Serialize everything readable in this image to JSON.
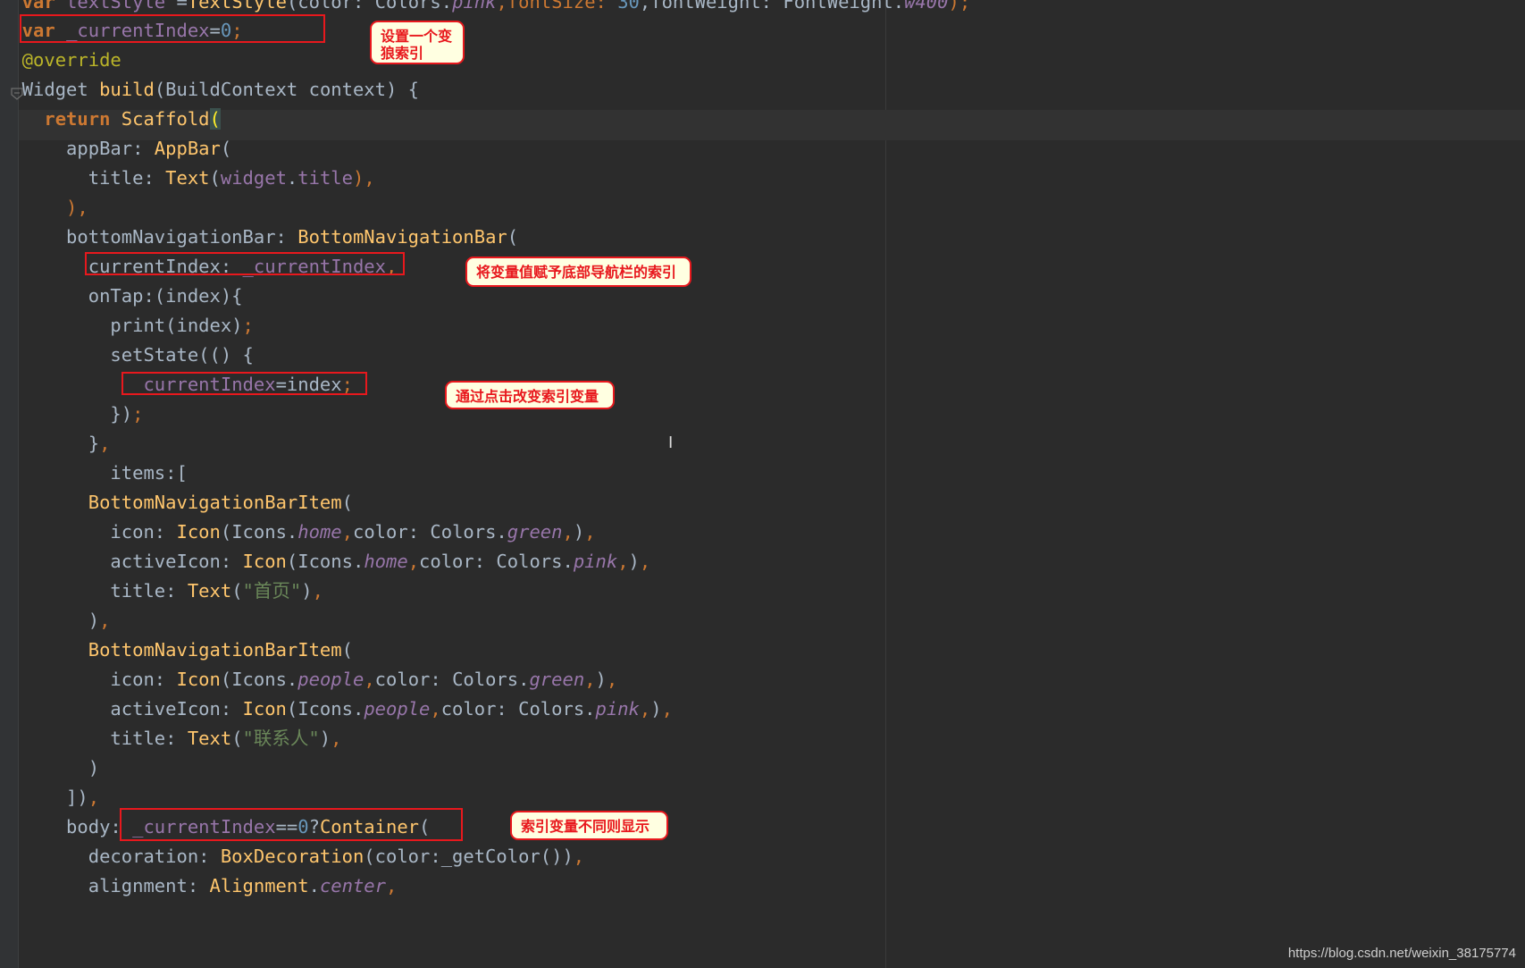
{
  "code_lines": [
    [
      {
        "t": "  var ",
        "c": "kw"
      },
      {
        "t": "textStyle",
        "c": "fld"
      },
      {
        "t": " =",
        "c": "plain"
      },
      {
        "t": "TextStyle",
        "c": "cls"
      },
      {
        "t": "(color: Colors.",
        "c": "plain"
      },
      {
        "t": "pink",
        "c": "it"
      },
      {
        "t": ",fontSize: ",
        "c": "pun"
      },
      {
        "t": "30",
        "c": "num"
      },
      {
        "t": ",fontWeight: FontWeight.",
        "c": "plain"
      },
      {
        "t": "w400",
        "c": "it"
      },
      {
        "t": ");",
        "c": "pun"
      }
    ],
    [
      {
        "t": "  var ",
        "c": "kw"
      },
      {
        "t": "_currentIndex",
        "c": "fld"
      },
      {
        "t": "=",
        "c": "plain"
      },
      {
        "t": "0",
        "c": "num"
      },
      {
        "t": ";",
        "c": "pun"
      }
    ],
    [
      {
        "t": "  @override",
        "c": "ann"
      }
    ],
    [
      {
        "t": "  Widget ",
        "c": "plain"
      },
      {
        "t": "build",
        "c": "cls"
      },
      {
        "t": "(BuildContext context) {",
        "c": "plain"
      }
    ],
    [
      {
        "t": "    return ",
        "c": "kw"
      },
      {
        "t": "Scaffold",
        "c": "cls"
      },
      {
        "t": "(",
        "c": "paren-hl"
      }
    ],
    [
      {
        "t": "      appBar: ",
        "c": "plain"
      },
      {
        "t": "AppBar",
        "c": "cls"
      },
      {
        "t": "(",
        "c": "plain"
      }
    ],
    [
      {
        "t": "        title: ",
        "c": "plain"
      },
      {
        "t": "Text",
        "c": "cls"
      },
      {
        "t": "(",
        "c": "plain"
      },
      {
        "t": "widget",
        "c": "fld"
      },
      {
        "t": ".",
        "c": "plain"
      },
      {
        "t": "title",
        "c": "fld"
      },
      {
        "t": "),",
        "c": "pun"
      }
    ],
    [
      {
        "t": "      ),",
        "c": "pun"
      }
    ],
    [
      {
        "t": "      bottomNavigationBar: ",
        "c": "plain"
      },
      {
        "t": "BottomNavigationBar",
        "c": "cls"
      },
      {
        "t": "(",
        "c": "plain"
      }
    ],
    [
      {
        "t": "        currentIndex: ",
        "c": "plain"
      },
      {
        "t": "_currentIndex",
        "c": "fld"
      },
      {
        "t": ",",
        "c": "pun"
      }
    ],
    [
      {
        "t": "        onTap:(index){",
        "c": "plain"
      }
    ],
    [
      {
        "t": "          print(index)",
        "c": "plain"
      },
      {
        "t": ";",
        "c": "pun"
      }
    ],
    [
      {
        "t": "          setState(() {",
        "c": "plain"
      }
    ],
    [
      {
        "t": "            ",
        "c": "plain"
      },
      {
        "t": "_currentIndex",
        "c": "fld"
      },
      {
        "t": "=index",
        "c": "plain"
      },
      {
        "t": ";",
        "c": "pun"
      }
    ],
    [
      {
        "t": "          })",
        "c": "plain"
      },
      {
        "t": ";",
        "c": "pun"
      }
    ],
    [
      {
        "t": "        }",
        "c": "plain"
      },
      {
        "t": ",",
        "c": "pun"
      }
    ],
    [
      {
        "t": "          items:[",
        "c": "plain"
      }
    ],
    [
      {
        "t": "        ",
        "c": "plain"
      },
      {
        "t": "BottomNavigationBarItem",
        "c": "cls"
      },
      {
        "t": "(",
        "c": "plain"
      }
    ],
    [
      {
        "t": "          icon: ",
        "c": "plain"
      },
      {
        "t": "Icon",
        "c": "cls"
      },
      {
        "t": "(Icons.",
        "c": "plain"
      },
      {
        "t": "home",
        "c": "it"
      },
      {
        "t": ",",
        "c": "pun"
      },
      {
        "t": "color: Colors.",
        "c": "plain"
      },
      {
        "t": "green",
        "c": "it"
      },
      {
        "t": ",",
        "c": "pun"
      },
      {
        "t": ")",
        "c": "plain"
      },
      {
        "t": ",",
        "c": "pun"
      }
    ],
    [
      {
        "t": "          activeIcon: ",
        "c": "plain"
      },
      {
        "t": "Icon",
        "c": "cls"
      },
      {
        "t": "(Icons.",
        "c": "plain"
      },
      {
        "t": "home",
        "c": "it"
      },
      {
        "t": ",",
        "c": "pun"
      },
      {
        "t": "color: Colors.",
        "c": "plain"
      },
      {
        "t": "pink",
        "c": "it"
      },
      {
        "t": ",",
        "c": "pun"
      },
      {
        "t": ")",
        "c": "plain"
      },
      {
        "t": ",",
        "c": "pun"
      }
    ],
    [
      {
        "t": "          title: ",
        "c": "plain"
      },
      {
        "t": "Text",
        "c": "cls"
      },
      {
        "t": "(",
        "c": "plain"
      },
      {
        "t": "\"首页\"",
        "c": "str"
      },
      {
        "t": ")",
        "c": "plain"
      },
      {
        "t": ",",
        "c": "pun"
      }
    ],
    [
      {
        "t": "        )",
        "c": "plain"
      },
      {
        "t": ",",
        "c": "pun"
      }
    ],
    [
      {
        "t": "        ",
        "c": "plain"
      },
      {
        "t": "BottomNavigationBarItem",
        "c": "cls"
      },
      {
        "t": "(",
        "c": "plain"
      }
    ],
    [
      {
        "t": "          icon: ",
        "c": "plain"
      },
      {
        "t": "Icon",
        "c": "cls"
      },
      {
        "t": "(Icons.",
        "c": "plain"
      },
      {
        "t": "people",
        "c": "it"
      },
      {
        "t": ",",
        "c": "pun"
      },
      {
        "t": "color: Colors.",
        "c": "plain"
      },
      {
        "t": "green",
        "c": "it"
      },
      {
        "t": ",",
        "c": "pun"
      },
      {
        "t": ")",
        "c": "plain"
      },
      {
        "t": ",",
        "c": "pun"
      }
    ],
    [
      {
        "t": "          activeIcon: ",
        "c": "plain"
      },
      {
        "t": "Icon",
        "c": "cls"
      },
      {
        "t": "(Icons.",
        "c": "plain"
      },
      {
        "t": "people",
        "c": "it"
      },
      {
        "t": ",",
        "c": "pun"
      },
      {
        "t": "color: Colors.",
        "c": "plain"
      },
      {
        "t": "pink",
        "c": "it"
      },
      {
        "t": ",",
        "c": "pun"
      },
      {
        "t": ")",
        "c": "plain"
      },
      {
        "t": ",",
        "c": "pun"
      }
    ],
    [
      {
        "t": "          title: ",
        "c": "plain"
      },
      {
        "t": "Text",
        "c": "cls"
      },
      {
        "t": "(",
        "c": "plain"
      },
      {
        "t": "\"联系人\"",
        "c": "str"
      },
      {
        "t": ")",
        "c": "plain"
      },
      {
        "t": ",",
        "c": "pun"
      }
    ],
    [
      {
        "t": "        )",
        "c": "plain"
      }
    ],
    [
      {
        "t": "      ])",
        "c": "plain"
      },
      {
        "t": ",",
        "c": "pun"
      }
    ],
    [
      {
        "t": "      body: ",
        "c": "plain"
      },
      {
        "t": "_currentIndex",
        "c": "fld"
      },
      {
        "t": "==",
        "c": "plain"
      },
      {
        "t": "0",
        "c": "num"
      },
      {
        "t": "?",
        "c": "plain"
      },
      {
        "t": "Container",
        "c": "cls"
      },
      {
        "t": "(",
        "c": "plain"
      }
    ],
    [
      {
        "t": "        decoration: ",
        "c": "plain"
      },
      {
        "t": "BoxDecoration",
        "c": "cls"
      },
      {
        "t": "(color:_getColor())",
        "c": "plain"
      },
      {
        "t": ",",
        "c": "pun"
      }
    ],
    [
      {
        "t": "        alignment: ",
        "c": "plain"
      },
      {
        "t": "Alignment",
        "c": "cls"
      },
      {
        "t": ".",
        "c": "plain"
      },
      {
        "t": "center",
        "c": "it"
      },
      {
        "t": ",",
        "c": "pun"
      }
    ]
  ],
  "callouts": {
    "c1": "设置一个变\n狼索引",
    "c2": "将变量值赋予底部导航栏的索引",
    "c3": "通过点击改变索引变量",
    "c4": "索引变量不同则显示"
  },
  "watermark": "https://blog.csdn.net/weixin_38175774",
  "colors": {
    "background": "#2b2b2b",
    "keyword": "#cc7832",
    "class_name": "#ffc66d",
    "field": "#9876aa",
    "string": "#6a8759",
    "annotation": "#bbb529",
    "number": "#6897bb",
    "default_text": "#a9b7c6",
    "highlight_border": "#e8181d",
    "callout_fill": "#ffffe1"
  }
}
